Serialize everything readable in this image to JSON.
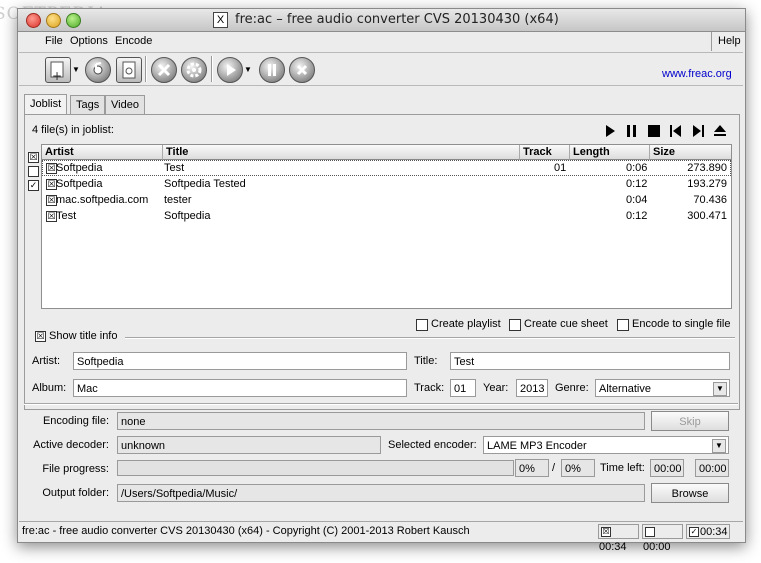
{
  "watermark": "SOFTPEDIA",
  "window": {
    "title": "fre:ac – free audio converter CVS 20130430 (x64)",
    "title_icon": "X"
  },
  "menu": {
    "file": "File",
    "options": "Options",
    "encode": "Encode",
    "help": "Help"
  },
  "toolbar": {
    "link": "www.freac.org",
    "icons": [
      "add-files-icon",
      "cd-icon",
      "add-cd-icon",
      "tools-icon",
      "settings-icon",
      "play-icon",
      "pause-icon",
      "stop-icon"
    ]
  },
  "tabs": [
    "Joblist",
    "Tags",
    "Video"
  ],
  "joblist": {
    "count_label": "4 file(s) in joblist:",
    "columns": [
      "Artist",
      "Title",
      "Track",
      "Length",
      "Size"
    ],
    "rows": [
      {
        "checked": "☒",
        "artist": "Softpedia",
        "title": "Test",
        "track": "01",
        "length": "0:06",
        "size": "273.890"
      },
      {
        "checked": "☒",
        "artist": "Softpedia",
        "title": "Softpedia Tested",
        "track": "",
        "length": "0:12",
        "size": "193.279"
      },
      {
        "checked": "☒",
        "artist": "mac.softpedia.com",
        "title": "tester",
        "track": "",
        "length": "0:04",
        "size": "70.436"
      },
      {
        "checked": "☒",
        "artist": "Test",
        "title": "Softpedia",
        "track": "",
        "length": "0:12",
        "size": "300.471"
      }
    ],
    "side_checks": [
      "☒",
      "",
      "✓"
    ],
    "options": {
      "playlist": "Create playlist",
      "cue": "Create cue sheet",
      "single": "Encode to single file"
    }
  },
  "title_info": {
    "toggle": "Show title info",
    "artist_label": "Artist:",
    "artist_value": "Softpedia",
    "title_label": "Title:",
    "title_value": "Test",
    "album_label": "Album:",
    "album_value": "Mac",
    "track_label": "Track:",
    "track_value": "01",
    "year_label": "Year:",
    "year_value": "2013",
    "genre_label": "Genre:",
    "genre_value": "Alternative"
  },
  "encoding": {
    "file_label": "Encoding file:",
    "file_value": "none",
    "skip": "Skip",
    "decoder_label": "Active decoder:",
    "decoder_value": "unknown",
    "encoder_label": "Selected encoder:",
    "encoder_value": "LAME MP3 Encoder",
    "progress_label": "File progress:",
    "progress_pct": "0%",
    "progress_sep": "/",
    "total_pct": "0%",
    "file_progress": 0,
    "time_label": "Time left:",
    "time_left": "00:00",
    "time_total": "00:00",
    "output_label": "Output folder:",
    "output_value": "/Users/Softpedia/Music/",
    "browse": "Browse"
  },
  "status": {
    "text": "fre:ac - free audio converter CVS 20130430 (x64) - Copyright (C) 2001-2013 Robert Kausch",
    "t1": "00:34",
    "t2": "00:00",
    "t3": "00:34",
    "c1": "☒",
    "c2": "",
    "c3": "✓"
  }
}
